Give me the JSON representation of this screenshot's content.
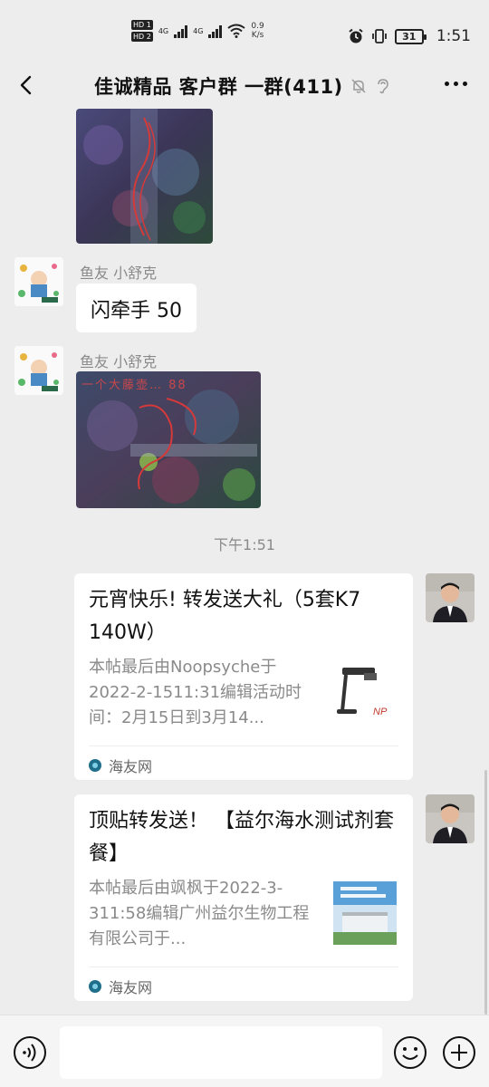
{
  "status_bar": {
    "hd1": "HD 1",
    "hd2": "HD 2",
    "net1": "4G",
    "net2": "4G",
    "speed_value": "0.9",
    "speed_unit": "K/s",
    "battery": "31",
    "time": "1:51"
  },
  "nav": {
    "title": "佳诚精品 客户群 一群(411)"
  },
  "messages": {
    "sender1": "鱼友 小舒克",
    "text1": "闪牵手 50",
    "sender2": "鱼友 小舒克",
    "image_caption_overlay": "一个大藤壶… 88"
  },
  "time_separator": "下午1:51",
  "card1": {
    "title": "元宵快乐! 转发送大礼（5套K7 140W）",
    "desc": "本帖最后由Noopsyche于2022-2-1511:31编辑活动时间：2月15日到3月14...",
    "source": "海友网"
  },
  "card2": {
    "title": "顶贴转发送！ 【益尔海水测试剂套餐】",
    "desc": "本帖最后由飒枫于2022-3-311:58编辑广州益尔生物工程有限公司于...",
    "source": "海友网"
  },
  "icons": {
    "back": "chevron-left-icon",
    "mute": "bell-off-icon",
    "ear": "ear-icon",
    "more": "more-icon",
    "voice": "voice-icon",
    "emoji": "emoji-icon",
    "plus": "plus-icon"
  }
}
